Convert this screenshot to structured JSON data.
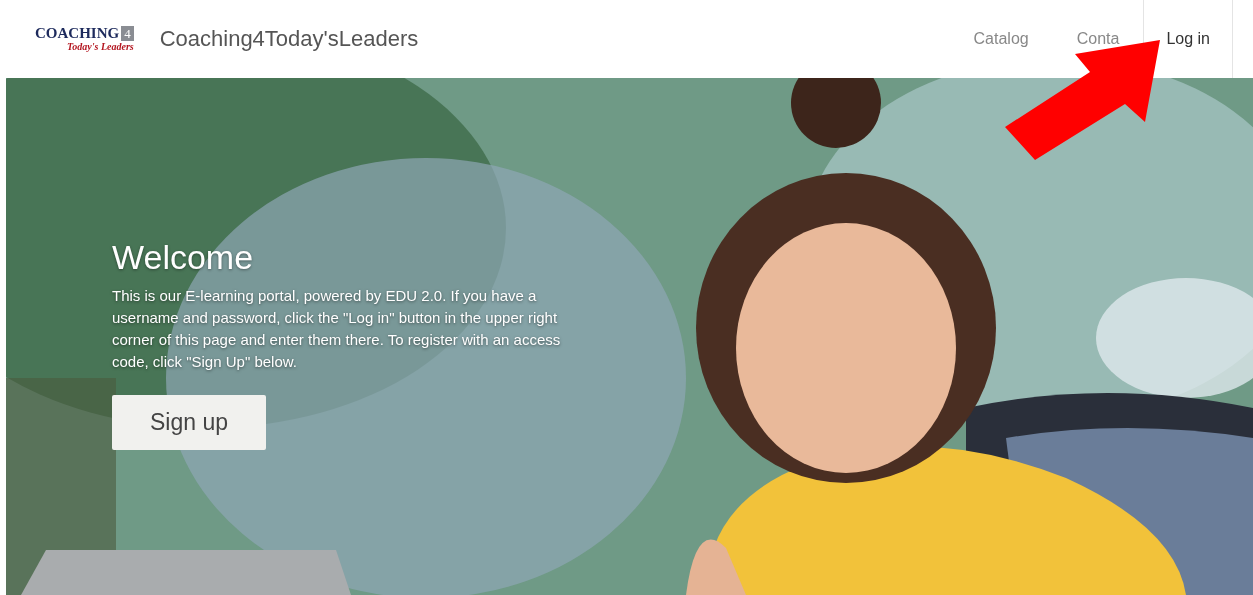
{
  "header": {
    "logo": {
      "word": "COACHING",
      "number": "4",
      "tagline": "Today's Leaders"
    },
    "site_title": "Coaching4Today'sLeaders",
    "nav": [
      {
        "label": "Catalog",
        "kind": "plain"
      },
      {
        "label": "Conta",
        "kind": "plain"
      },
      {
        "label": "Log in",
        "kind": "boxed"
      }
    ]
  },
  "annotation": {
    "kind": "arrow"
  },
  "hero": {
    "title": "Welcome",
    "text": "This is our E-learning portal, powered by EDU 2.0. If you have a username and password, click the \"Log in\" button in the upper right corner of this page and enter them there. To register with an access code, click \"Sign Up\" below.",
    "button": "Sign up"
  }
}
